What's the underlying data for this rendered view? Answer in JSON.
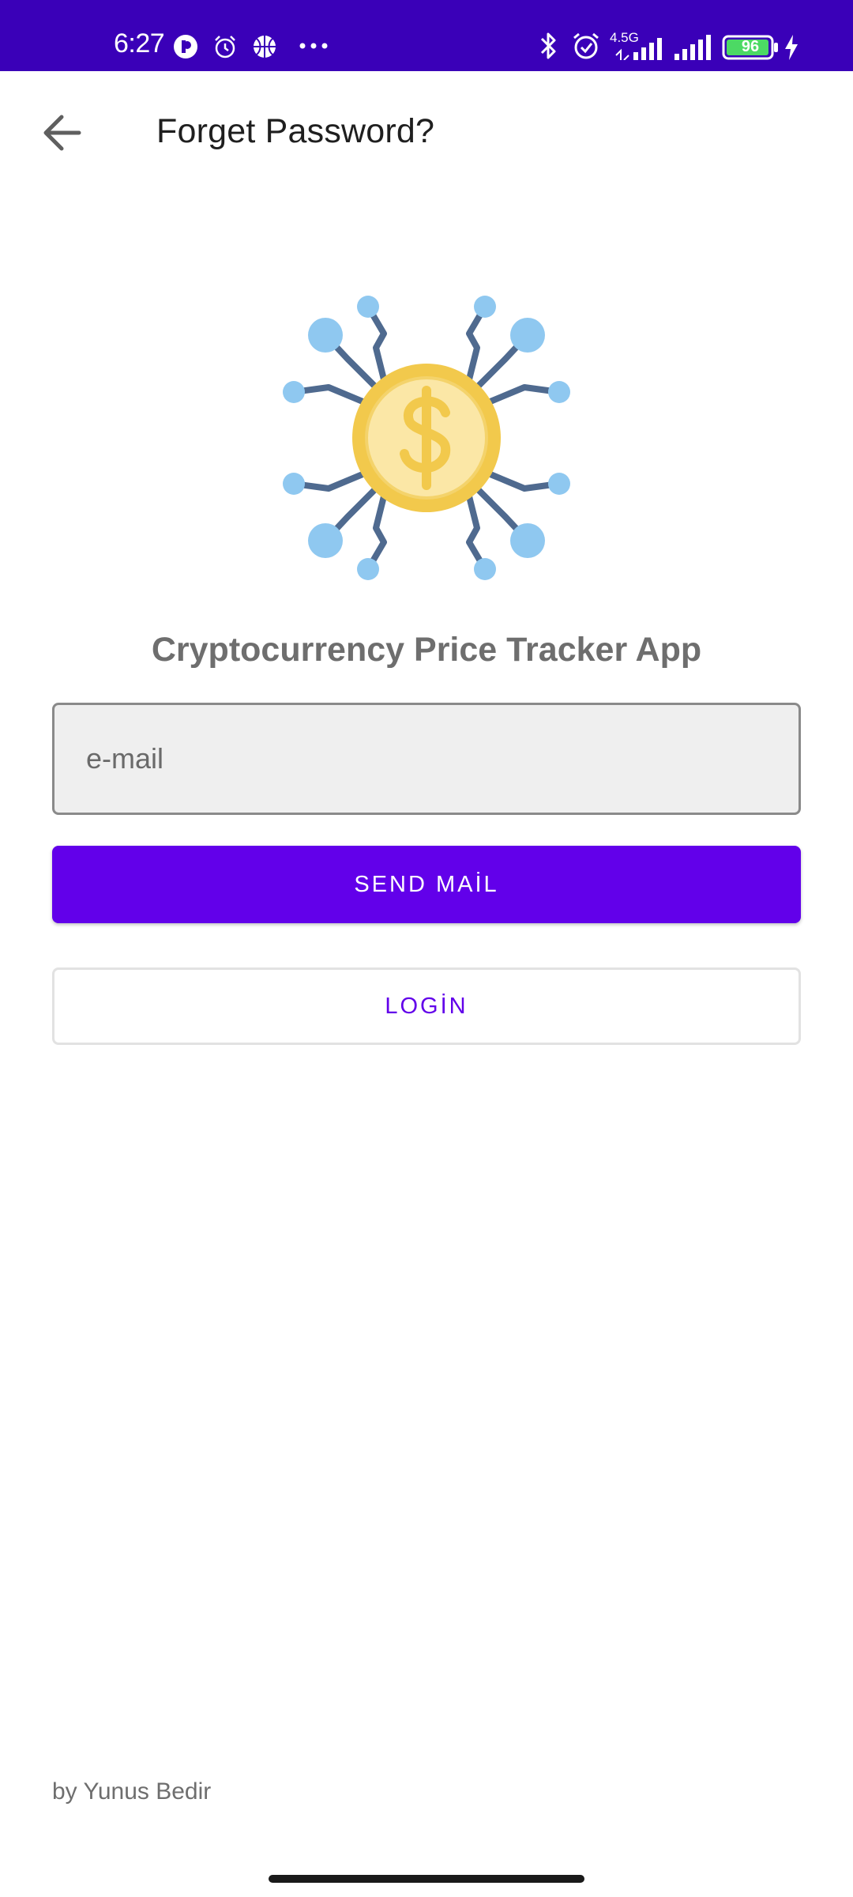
{
  "status_bar": {
    "time": "6:27",
    "network_label": "4.5G",
    "battery_level": "96",
    "background_color": "#3a00b8",
    "icons": [
      "app-notification-icon",
      "alarm-icon",
      "basketball-icon",
      "more-dots-icon",
      "bluetooth-icon",
      "alarm-clock-icon",
      "signal-icon",
      "signal-icon",
      "battery-icon",
      "charging-icon"
    ]
  },
  "appbar": {
    "back_icon": "arrow-left-icon",
    "title": "Forget Password?"
  },
  "logo": {
    "icon": "crypto-coin-network-icon"
  },
  "app_name": "Cryptocurrency Price Tracker App",
  "form": {
    "email_placeholder": "e-mail",
    "email_value": "",
    "send_label": "SEND MAİL",
    "login_label": "LOGİN"
  },
  "footer": {
    "credit": "by Yunus Bedir"
  },
  "colors": {
    "primary": "#6200ea",
    "status_bar": "#3a00b8",
    "coin": "#f7d774",
    "node": "#8fc8f0",
    "wire": "#4f6a8f"
  }
}
